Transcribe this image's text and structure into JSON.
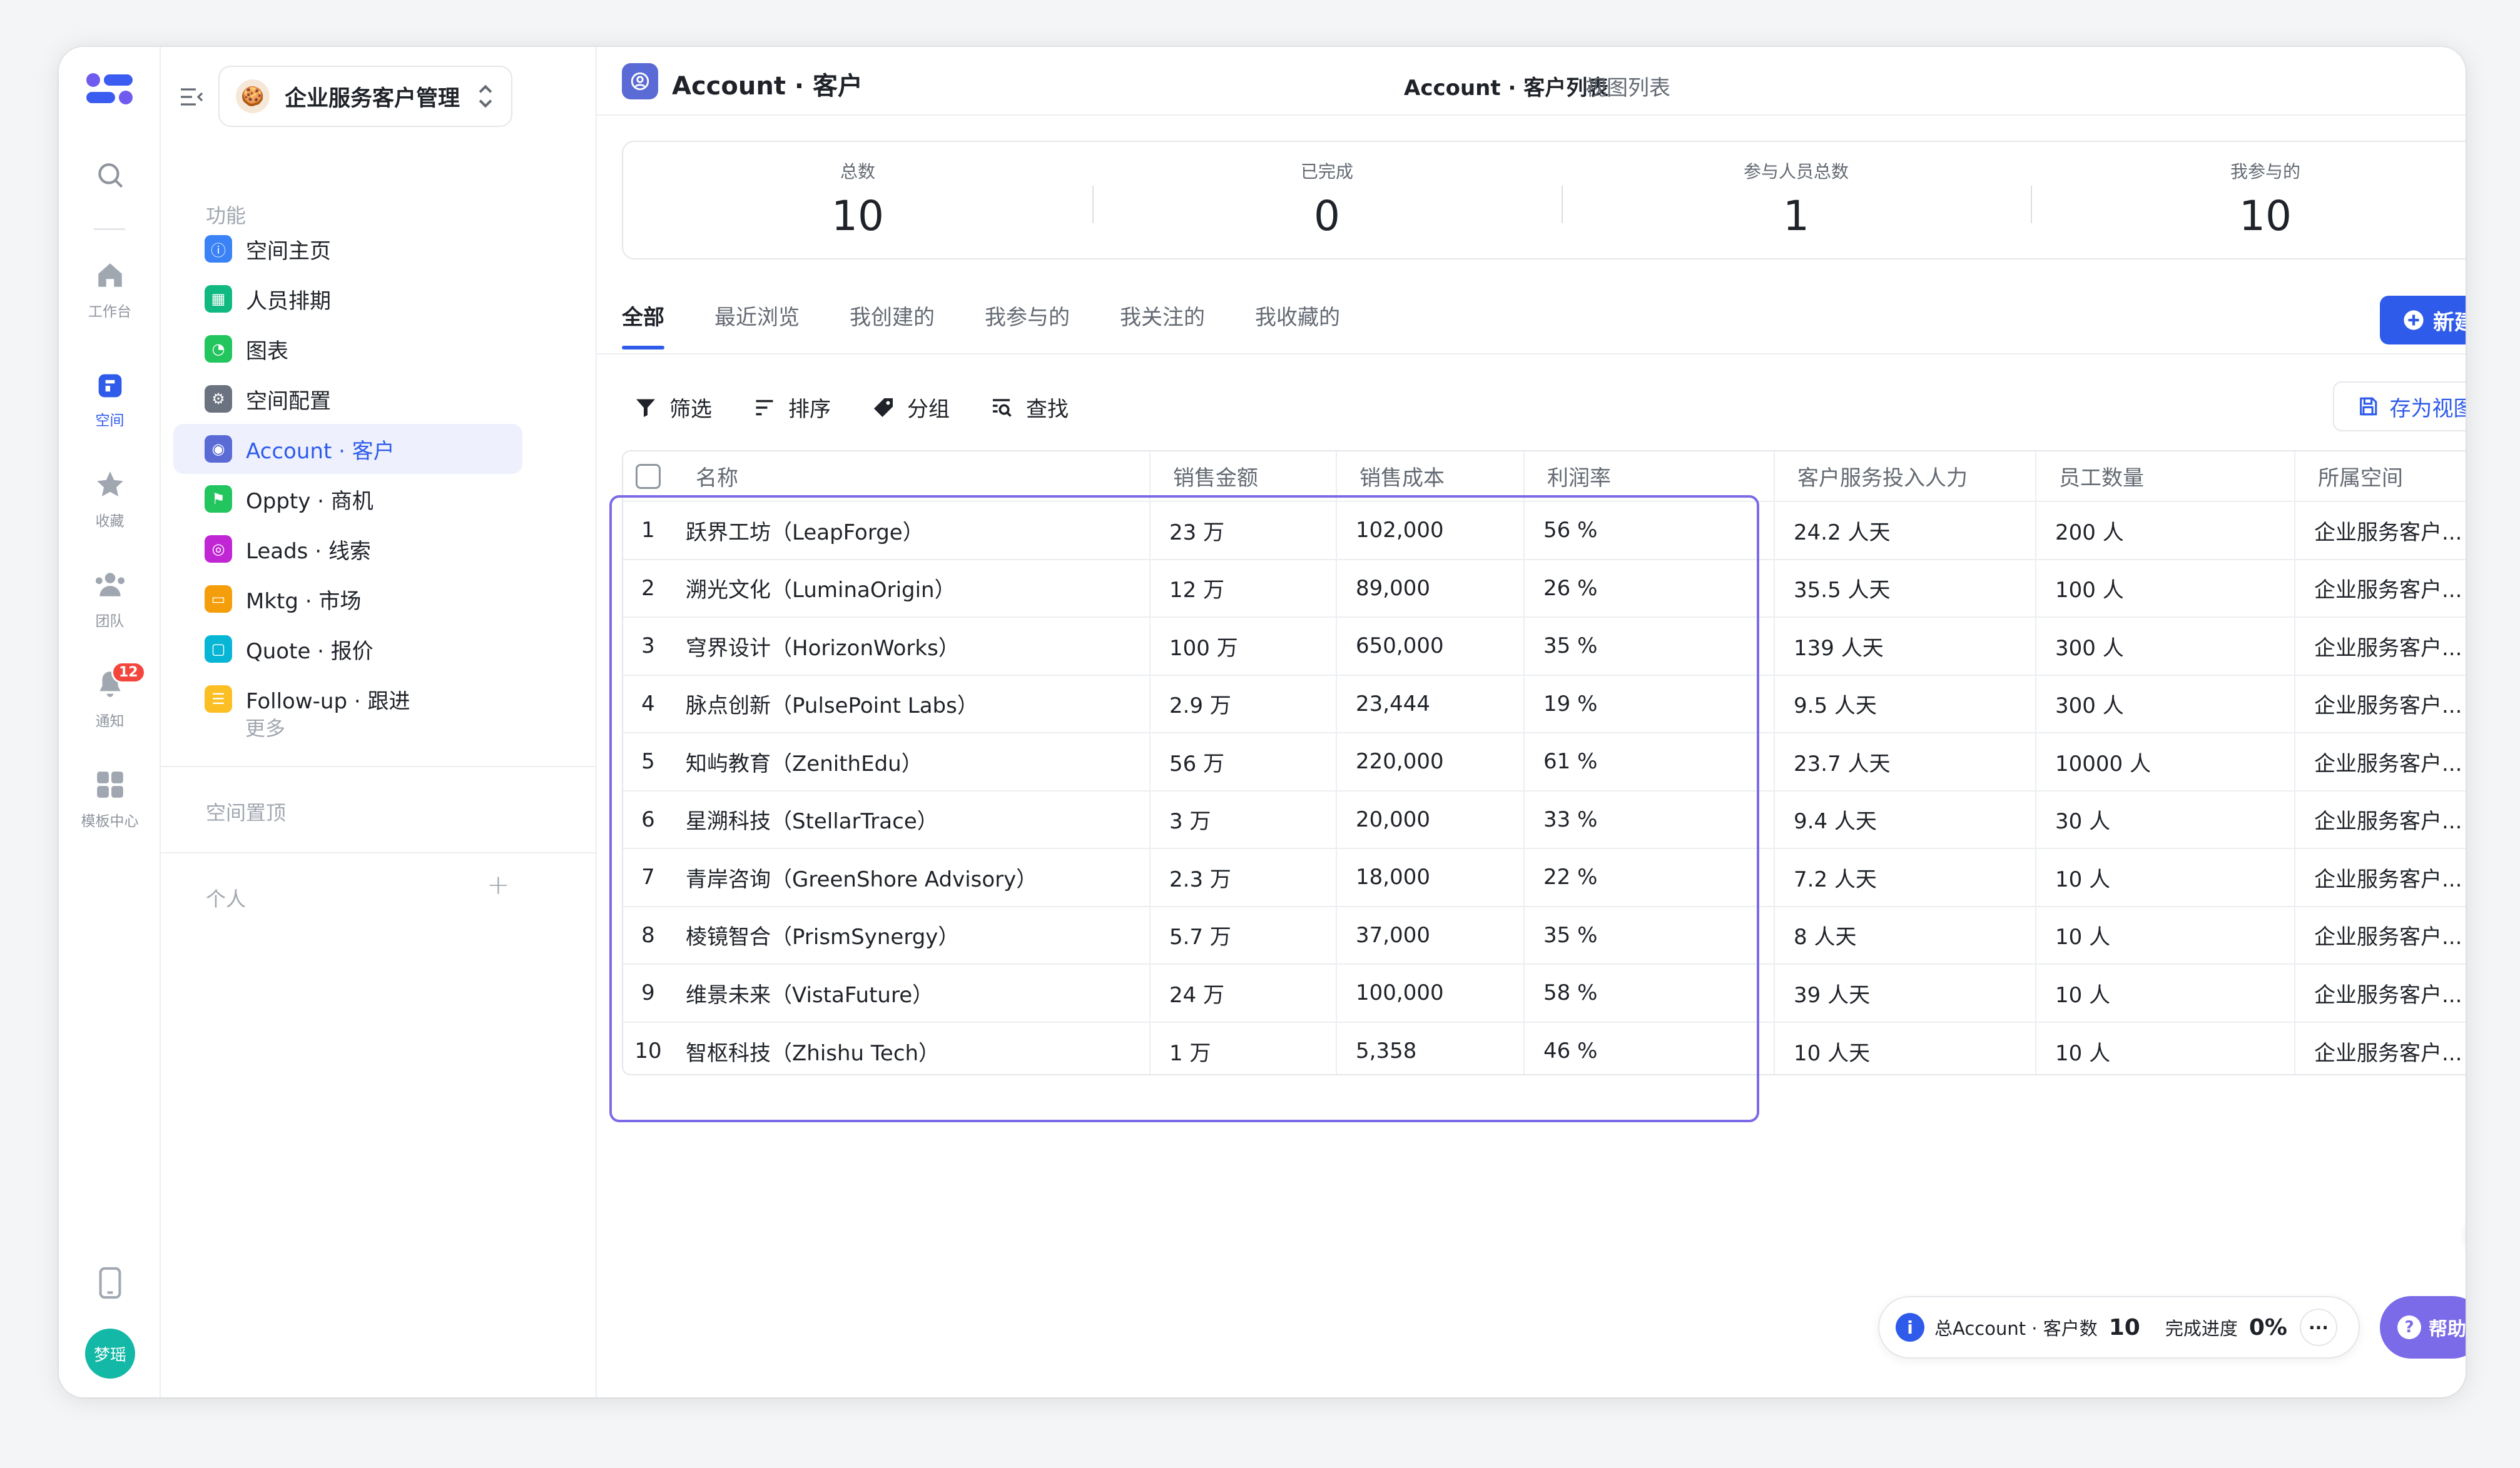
{
  "rail": {
    "items": [
      {
        "label": ""
      },
      {
        "label": "工作台"
      },
      {
        "label": "空间"
      },
      {
        "label": "收藏"
      },
      {
        "label": "团队"
      },
      {
        "label": "通知"
      },
      {
        "label": "模板中心"
      }
    ],
    "notification_count": "12",
    "avatar_text": "梦瑶"
  },
  "sidebar": {
    "space_name": "企业服务客户管理",
    "section_functions": "功能",
    "items": [
      {
        "label": "空间主页",
        "color": "#3b82f6"
      },
      {
        "label": "人员排期",
        "color": "#10b981"
      },
      {
        "label": "图表",
        "color": "#22c55e"
      },
      {
        "label": "空间配置",
        "color": "#6b7280"
      },
      {
        "label": "Account · 客户",
        "color": "#5b6bd6"
      },
      {
        "label": "Oppty · 商机",
        "color": "#22c55e"
      },
      {
        "label": "Leads · 线索",
        "color": "#c026d3"
      },
      {
        "label": "Mktg · 市场",
        "color": "#f59e0b"
      },
      {
        "label": "Quote · 报价",
        "color": "#06b6d4"
      },
      {
        "label": "Follow-up · 跟进",
        "color": "#fbbf24"
      }
    ],
    "more": "更多",
    "section_pinned": "空间置顶",
    "section_personal": "个人"
  },
  "header": {
    "title": "Account · 客户",
    "tab_active": "Account · 客户列表",
    "tab_other": "视图列表"
  },
  "stats": [
    {
      "label": "总数",
      "value": "10"
    },
    {
      "label": "已完成",
      "value": "0"
    },
    {
      "label": "参与人员总数",
      "value": "1"
    },
    {
      "label": "我参与的",
      "value": "10"
    }
  ],
  "tabs": [
    "全部",
    "最近浏览",
    "我创建的",
    "我参与的",
    "我关注的",
    "我收藏的"
  ],
  "new_button": "新建",
  "toolbar": {
    "filter": "筛选",
    "sort": "排序",
    "group": "分组",
    "find": "查找",
    "save_view": "存为视图"
  },
  "table": {
    "columns": [
      "名称",
      "销售金额",
      "销售成本",
      "利润率",
      "客户服务投入人力",
      "员工数量",
      "所属空间"
    ],
    "rows": [
      [
        "1",
        "跃界工坊（LeapForge）",
        "23 万",
        "102,000",
        "56 %",
        "24.2 人天",
        "200 人",
        "企业服务客户..."
      ],
      [
        "2",
        "溯光文化（LuminaOrigin）",
        "12 万",
        "89,000",
        "26 %",
        "35.5 人天",
        "100 人",
        "企业服务客户..."
      ],
      [
        "3",
        "穹界设计（HorizonWorks）",
        "100 万",
        "650,000",
        "35 %",
        "139 人天",
        "300 人",
        "企业服务客户..."
      ],
      [
        "4",
        "脉点创新（PulsePoint Labs）",
        "2.9 万",
        "23,444",
        "19 %",
        "9.5 人天",
        "300 人",
        "企业服务客户..."
      ],
      [
        "5",
        "知屿教育（ZenithEdu）",
        "56 万",
        "220,000",
        "61 %",
        "23.7 人天",
        "10000 人",
        "企业服务客户..."
      ],
      [
        "6",
        "星溯科技（StellarTrace）",
        "3 万",
        "20,000",
        "33 %",
        "9.4 人天",
        "30 人",
        "企业服务客户..."
      ],
      [
        "7",
        "青岸咨询（GreenShore Advisory）",
        "2.3 万",
        "18,000",
        "22 %",
        "7.2 人天",
        "10 人",
        "企业服务客户..."
      ],
      [
        "8",
        "棱镜智合（PrismSynergy）",
        "5.7 万",
        "37,000",
        "35 %",
        "8 人天",
        "10 人",
        "企业服务客户..."
      ],
      [
        "9",
        "维景未来（VistaFuture）",
        "24 万",
        "100,000",
        "58 %",
        "39 人天",
        "10 人",
        "企业服务客户..."
      ],
      [
        "10",
        "智枢科技（Zhishu Tech）",
        "1 万",
        "5,358",
        "46 %",
        "10 人天",
        "10 人",
        "企业服务客户..."
      ]
    ]
  },
  "status_bar": {
    "label": "总Account · 客户数",
    "count": "10",
    "progress_label": "完成进度",
    "progress_value": "0%"
  },
  "help": "帮助",
  "colors": {
    "accent": "#2f5bea",
    "highlight": "#7c6be8"
  }
}
